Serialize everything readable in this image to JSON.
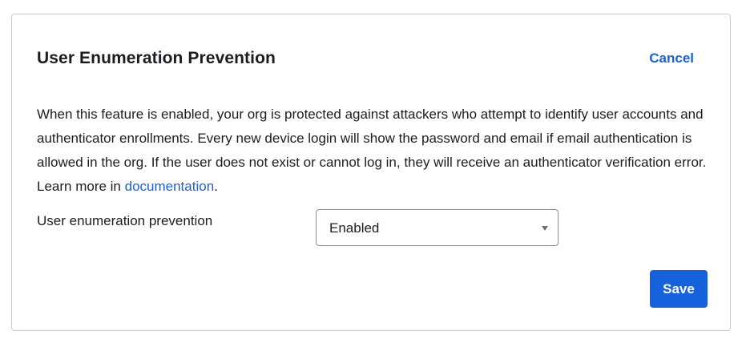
{
  "panel": {
    "title": "User Enumeration Prevention",
    "cancel_label": "Cancel"
  },
  "description": {
    "text": "When this feature is enabled, your org is protected against attackers who attempt to identify user accounts and authenticator enrollments. Every new device login will show the password and email if email authentication is allowed in the org. If the user does not exist or cannot log in, they will receive an authenticator verification error. Learn more in ",
    "link_label": "documentation",
    "suffix": "."
  },
  "field": {
    "label": "User enumeration prevention",
    "selected_value": "Enabled",
    "caret_icon": "caret-down-icon"
  },
  "actions": {
    "save_label": "Save"
  },
  "colors": {
    "accent": "#1662dd",
    "border": "#c9ccd1",
    "text": "#1d1d21"
  }
}
